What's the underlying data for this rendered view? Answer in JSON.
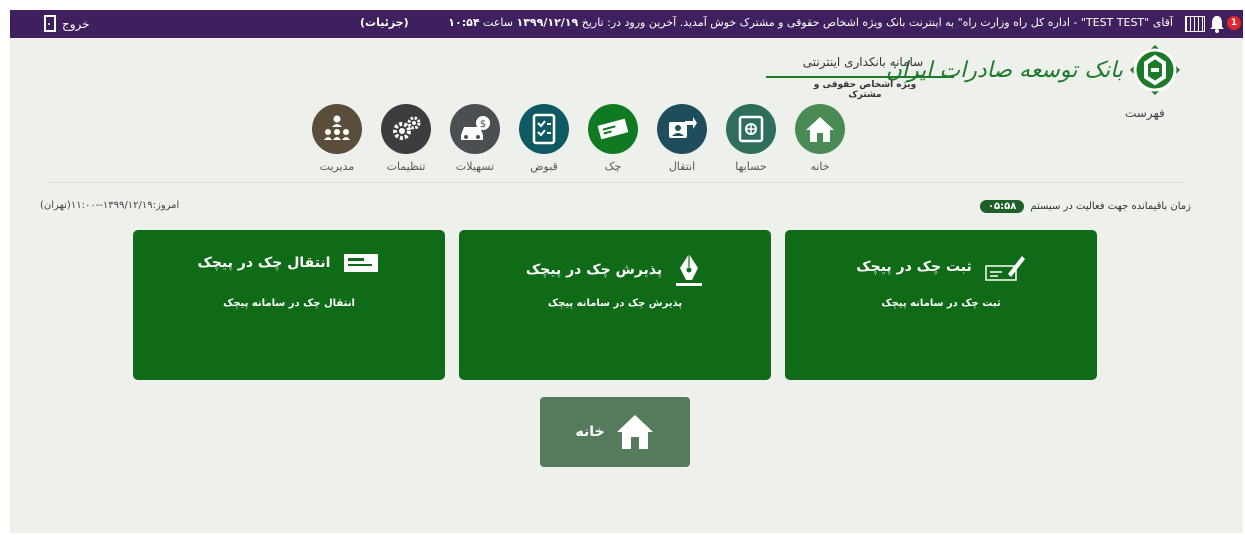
{
  "topbar": {
    "logout_label": "خروج",
    "details_label": "(جزئیات)",
    "welcome_prefix": "آقای \"",
    "user_name": "TEST TEST",
    "welcome_rest": "\" - اداره کل راه وزارت راه\" به اینترنت بانک ویژه اشخاص حقوقی و مشترک خوش آمدید. آخرین ورود در: تاریخ",
    "last_login_date": "۱۳۹۹/۱۲/۱۹",
    "time_word": "ساعت",
    "last_login_time": "۱۰:۵۴",
    "notification_count": "1"
  },
  "brand": {
    "bank_name": "بانک توسعه صادرات ایران",
    "system_title": "سامانه بانکداری اینترنتی",
    "system_subtitle": "ویژه اشخاص حقوقی و مشترک",
    "menu_label": "فهرست",
    "logo_color": "#1d7a2a"
  },
  "nav": [
    {
      "label": "خانه",
      "icon": "home-icon",
      "color": "#4a8a55"
    },
    {
      "label": "حسابها",
      "icon": "safe-icon",
      "color": "#2e6e5a"
    },
    {
      "label": "انتقال",
      "icon": "transfer-icon",
      "color": "#1f4d5c"
    },
    {
      "label": "چک",
      "icon": "cheque-icon",
      "color": "#0f7a22"
    },
    {
      "label": "قبوض",
      "icon": "bills-icon",
      "color": "#0f5a62"
    },
    {
      "label": "تسهیلات",
      "icon": "loan-icon",
      "color": "#4b4f52"
    },
    {
      "label": "تنظیمات",
      "icon": "gears-icon",
      "color": "#3d3d3d"
    },
    {
      "label": "مدیریت",
      "icon": "management-icon",
      "color": "#5a4e3a"
    }
  ],
  "status": {
    "today_label": "امروز:",
    "today_value": "۱۳۹۹/۱۲/۱۹--۱۱:۰۰(تهران)",
    "session_label": "زمان باقیمانده جهت فعالیت در سیستم",
    "session_timer": "۰۵:۵۸"
  },
  "cards": [
    {
      "title": "ثبت چک در پیچک",
      "desc": "ثبت چک در سامانه پیچک",
      "icon": "cheque-register-icon"
    },
    {
      "title": "پذیرش چک در پیچک",
      "desc": "پذیرش چک در سامانه پیچک",
      "icon": "pen-sign-icon"
    },
    {
      "title": "انتقال چک در پیچک",
      "desc": "انتقال چک در سامانه پیچک",
      "icon": "cheque-transfer-icon"
    }
  ],
  "home_button": {
    "label": "خانه",
    "icon": "home-icon"
  },
  "colors": {
    "topbar": "#3f1f5e",
    "card": "#0f6b17",
    "home_button": "#567a5c",
    "background": "#eef0ec"
  }
}
